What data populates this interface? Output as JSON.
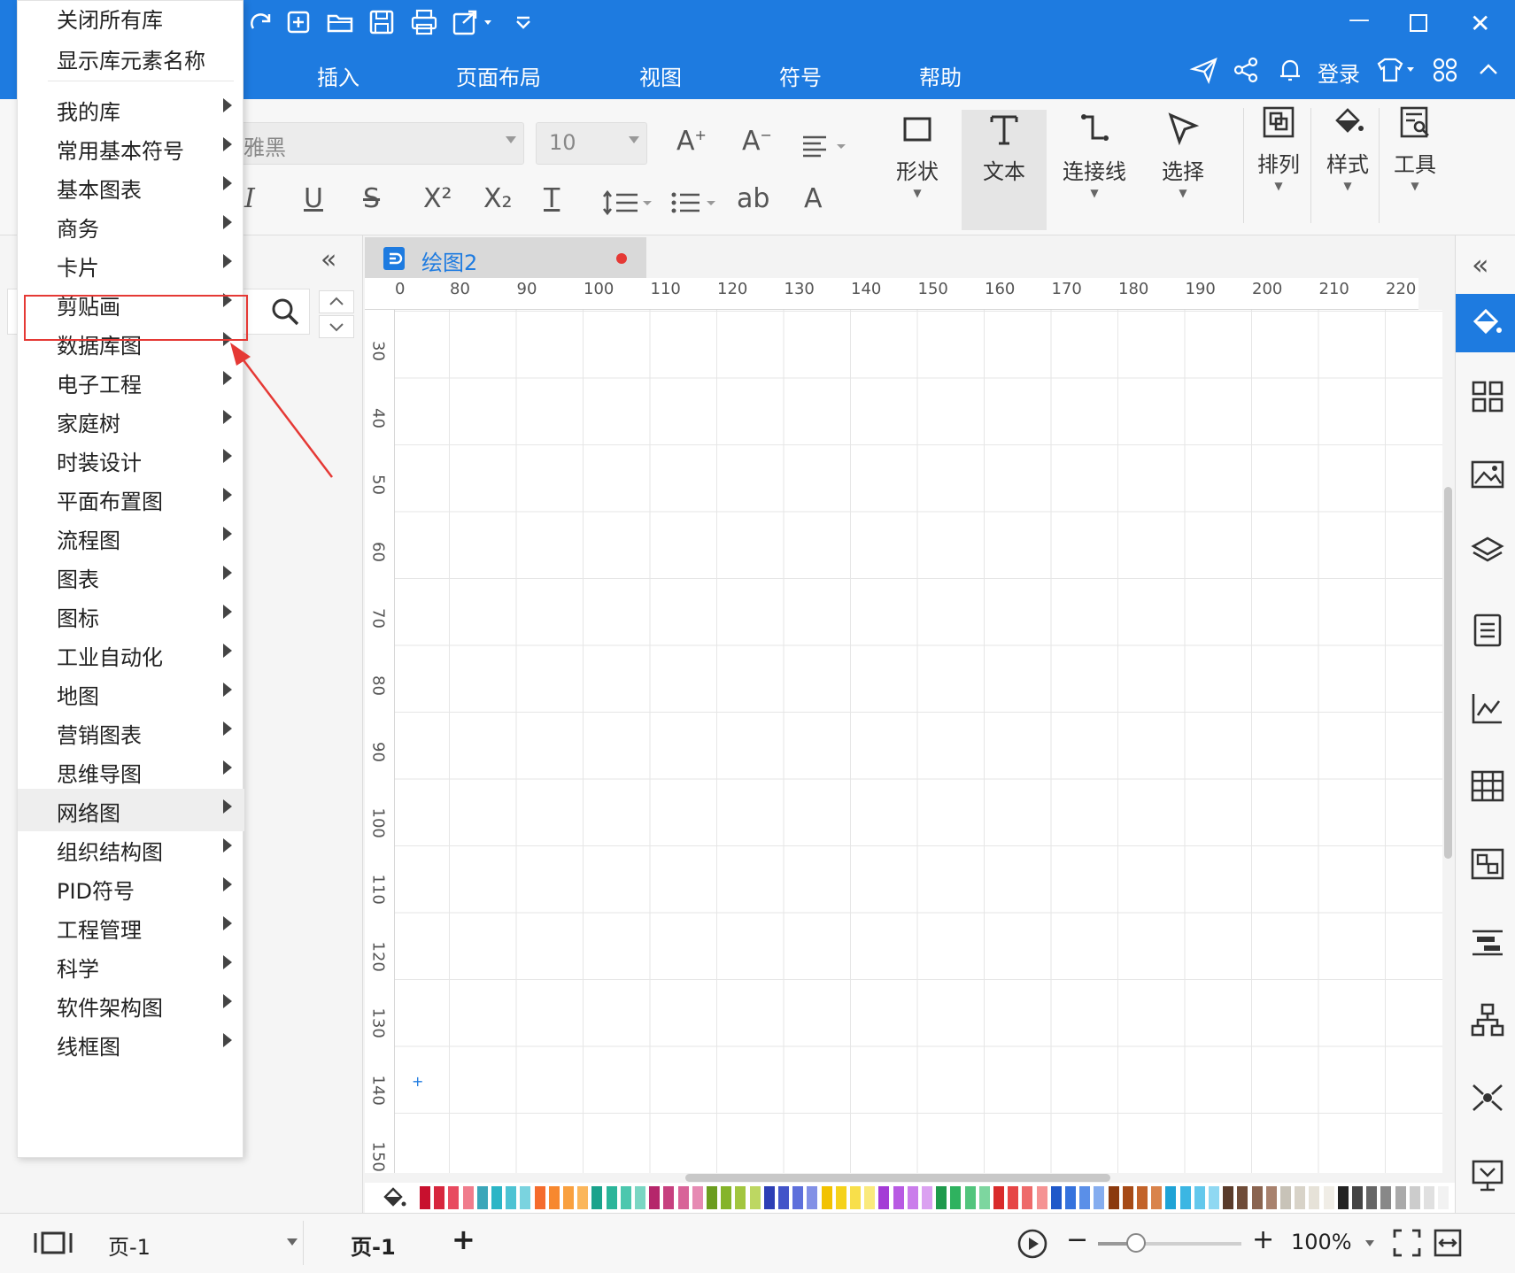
{
  "menu_tabs": [
    "插入",
    "页面布局",
    "视图",
    "符号",
    "帮助"
  ],
  "login_label": "登录",
  "font": {
    "name_partial": "雅黑",
    "size": "10"
  },
  "ribbon_buttons": {
    "shape": "形状",
    "text": "文本",
    "connector": "连接线",
    "select": "选择",
    "arrange": "排列",
    "style": "样式",
    "tools": "工具"
  },
  "format_glyphs": {
    "italic": "I",
    "underline": "U",
    "strike": "S",
    "superscript": "X²",
    "subscript": "X₂",
    "textcase": "T",
    "highlight": "ab",
    "fontcolor": "A"
  },
  "dropdown": {
    "top_items": [
      "关闭所有库",
      "显示库元素名称"
    ],
    "items": [
      "我的库",
      "常用基本符号",
      "基本图表",
      "商务",
      "卡片",
      "剪贴画",
      "数据库图",
      "电子工程",
      "家庭树",
      "时装设计",
      "平面布置图",
      "流程图",
      "图表",
      "图标",
      "工业自动化",
      "地图",
      "营销图表",
      "思维导图",
      "网络图",
      "组织结构图",
      "PID符号",
      "工程管理",
      "科学",
      "软件架构图",
      "线框图"
    ],
    "highlighted": "剪贴画",
    "hovered": "网络图"
  },
  "doc_tab": "绘图2",
  "ruler_h": [
    "0",
    "80",
    "90",
    "100",
    "110",
    "120",
    "130",
    "140",
    "150",
    "160",
    "170",
    "180",
    "190",
    "200",
    "210",
    "220"
  ],
  "ruler_v": [
    "30",
    "40",
    "50",
    "60",
    "70",
    "80",
    "90",
    "100",
    "110",
    "120",
    "130",
    "140",
    "150"
  ],
  "status": {
    "page_select": "页-1",
    "page_tab": "页-1",
    "add": "+",
    "zoom": "100%"
  },
  "colors": {
    "accent": "#1e7be0",
    "highlight_box": "#e53935",
    "swatches": [
      "#c8102e",
      "#d7263d",
      "#e84a5f",
      "#f07c8c",
      "#3aa6b9",
      "#2bb5c6",
      "#4dc3d3",
      "#7ad3df",
      "#f56c2d",
      "#f7882f",
      "#f9a03f",
      "#fbb65b",
      "#1aa38c",
      "#2bb59a",
      "#4cc7ae",
      "#7ad6c3",
      "#b5266b",
      "#c7407f",
      "#d86398",
      "#e68ab3",
      "#6b9d1f",
      "#85b42a",
      "#a2c63f",
      "#bdd762",
      "#2d3fb5",
      "#4254c9",
      "#5d6fdb",
      "#8290e6",
      "#f2c200",
      "#f5d21b",
      "#f8df4a",
      "#faea7d",
      "#a43bd6",
      "#b85ae3",
      "#ca7deb",
      "#db a1f1",
      "#1f9a4c",
      "#2fb25f",
      "#52c57d",
      "#7dd69f",
      "#d92a2a",
      "#e64545",
      "#ee6a6a",
      "#f59393",
      "#1f58c9",
      "#3572dd",
      "#5a8fe8",
      "#85adef",
      "#8b3a0e",
      "#a64a16",
      "#c2632a",
      "#d9834b",
      "#1fa3d6",
      "#3bb6e3",
      "#63c8ec",
      "#8fd8f2",
      "#5a3b2a",
      "#6f4c38",
      "#8a6450",
      "#a8826e",
      "#c8c3b8",
      "#d8d3c8",
      "#e6e2d8",
      "#f0ede6",
      "#222222",
      "#444444",
      "#666666",
      "#888888",
      "#aaaaaa",
      "#cccccc",
      "#e0e0e0",
      "#f2f2f2"
    ]
  }
}
